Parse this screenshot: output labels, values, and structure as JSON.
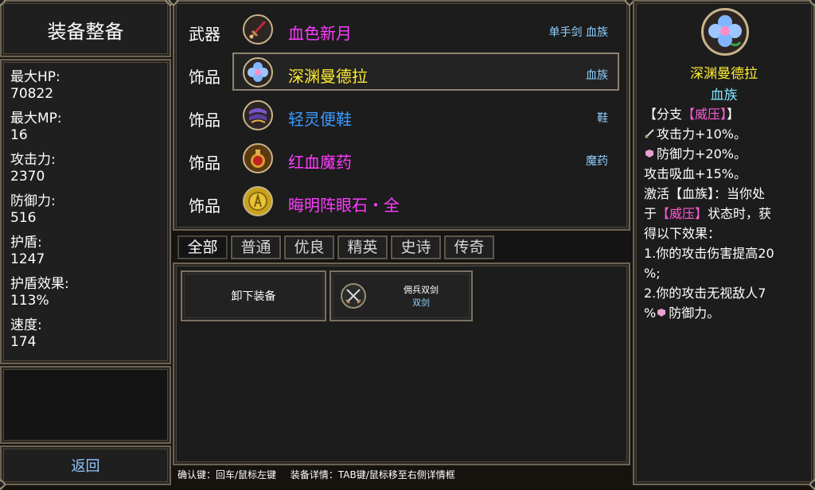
{
  "left": {
    "title": "装备整备",
    "stats": [
      {
        "label": "最大HP:",
        "value": "70822"
      },
      {
        "label": "最大MP:",
        "value": "16"
      },
      {
        "label": "攻击力:",
        "value": "2370"
      },
      {
        "label": "防御力:",
        "value": "516"
      },
      {
        "label": "护盾:",
        "value": "1247"
      },
      {
        "label": "护盾效果:",
        "value": "113%"
      },
      {
        "label": "速度:",
        "value": "174"
      }
    ],
    "back_label": "返回"
  },
  "equipment": [
    {
      "slot": "武器",
      "name": "血色新月",
      "name_color": "#ff3cff",
      "tags": "单手剑 血族",
      "icon": "crimson-sword-icon"
    },
    {
      "slot": "饰品",
      "name": "深渊曼德拉",
      "name_color": "#ffee33",
      "tags": "血族",
      "icon": "blue-flower-icon"
    },
    {
      "slot": "饰品",
      "name": "轻灵便鞋",
      "name_color": "#3b9bff",
      "tags": "鞋",
      "icon": "purple-boots-icon"
    },
    {
      "slot": "饰品",
      "name": "红血魔药",
      "name_color": "#ff3cff",
      "tags": "魔药",
      "icon": "red-potion-icon"
    },
    {
      "slot": "饰品",
      "name": "晦明阵眼石・全",
      "name_color": "#ff3cff",
      "tags": "",
      "icon": "gold-rune-stone-icon"
    }
  ],
  "tabs": [
    "全部",
    "普通",
    "优良",
    "精英",
    "史诗",
    "传奇"
  ],
  "items": {
    "unequip_label": "卸下装备",
    "merc_name": "佣兵双剑",
    "merc_type": "双剑",
    "merc_icon": "crossed-swords-icon"
  },
  "hint": {
    "confirm": "确认键：回车/鼠标左键",
    "detail": "装备详情：TAB键/鼠标移至右侧详情框"
  },
  "detail": {
    "icon": "blue-flower-icon",
    "name": "深渊曼德拉",
    "family": "血族",
    "branch_open": "【分支",
    "branch_tag": "【威压】",
    "branch_close": "】",
    "line_atk": "攻击力+10%。",
    "line_def": "防御力+20%。",
    "line_drain": "攻击吸血+15%。",
    "line_activate": "激活【血族】：当你处",
    "line_in": "于",
    "line_state_tag": "【威压】",
    "line_state_rest": "状态时，获",
    "line_gain": "得以下效果：",
    "line_e1a": "1.你的攻击伤害提高20",
    "line_e1b": "%;",
    "line_e2a": "2.你的攻击无视敌人7",
    "line_e2b_pre": "%",
    "line_e2b_post": "防御力。"
  },
  "colors": {
    "accent_blue": "#8fd0ff",
    "name_yellow": "#ffee33",
    "name_pink": "#ff3cff",
    "name_blue": "#3b9bff",
    "tag_pink": "#ff5ad8",
    "family_cyan": "#7fe3ff"
  }
}
